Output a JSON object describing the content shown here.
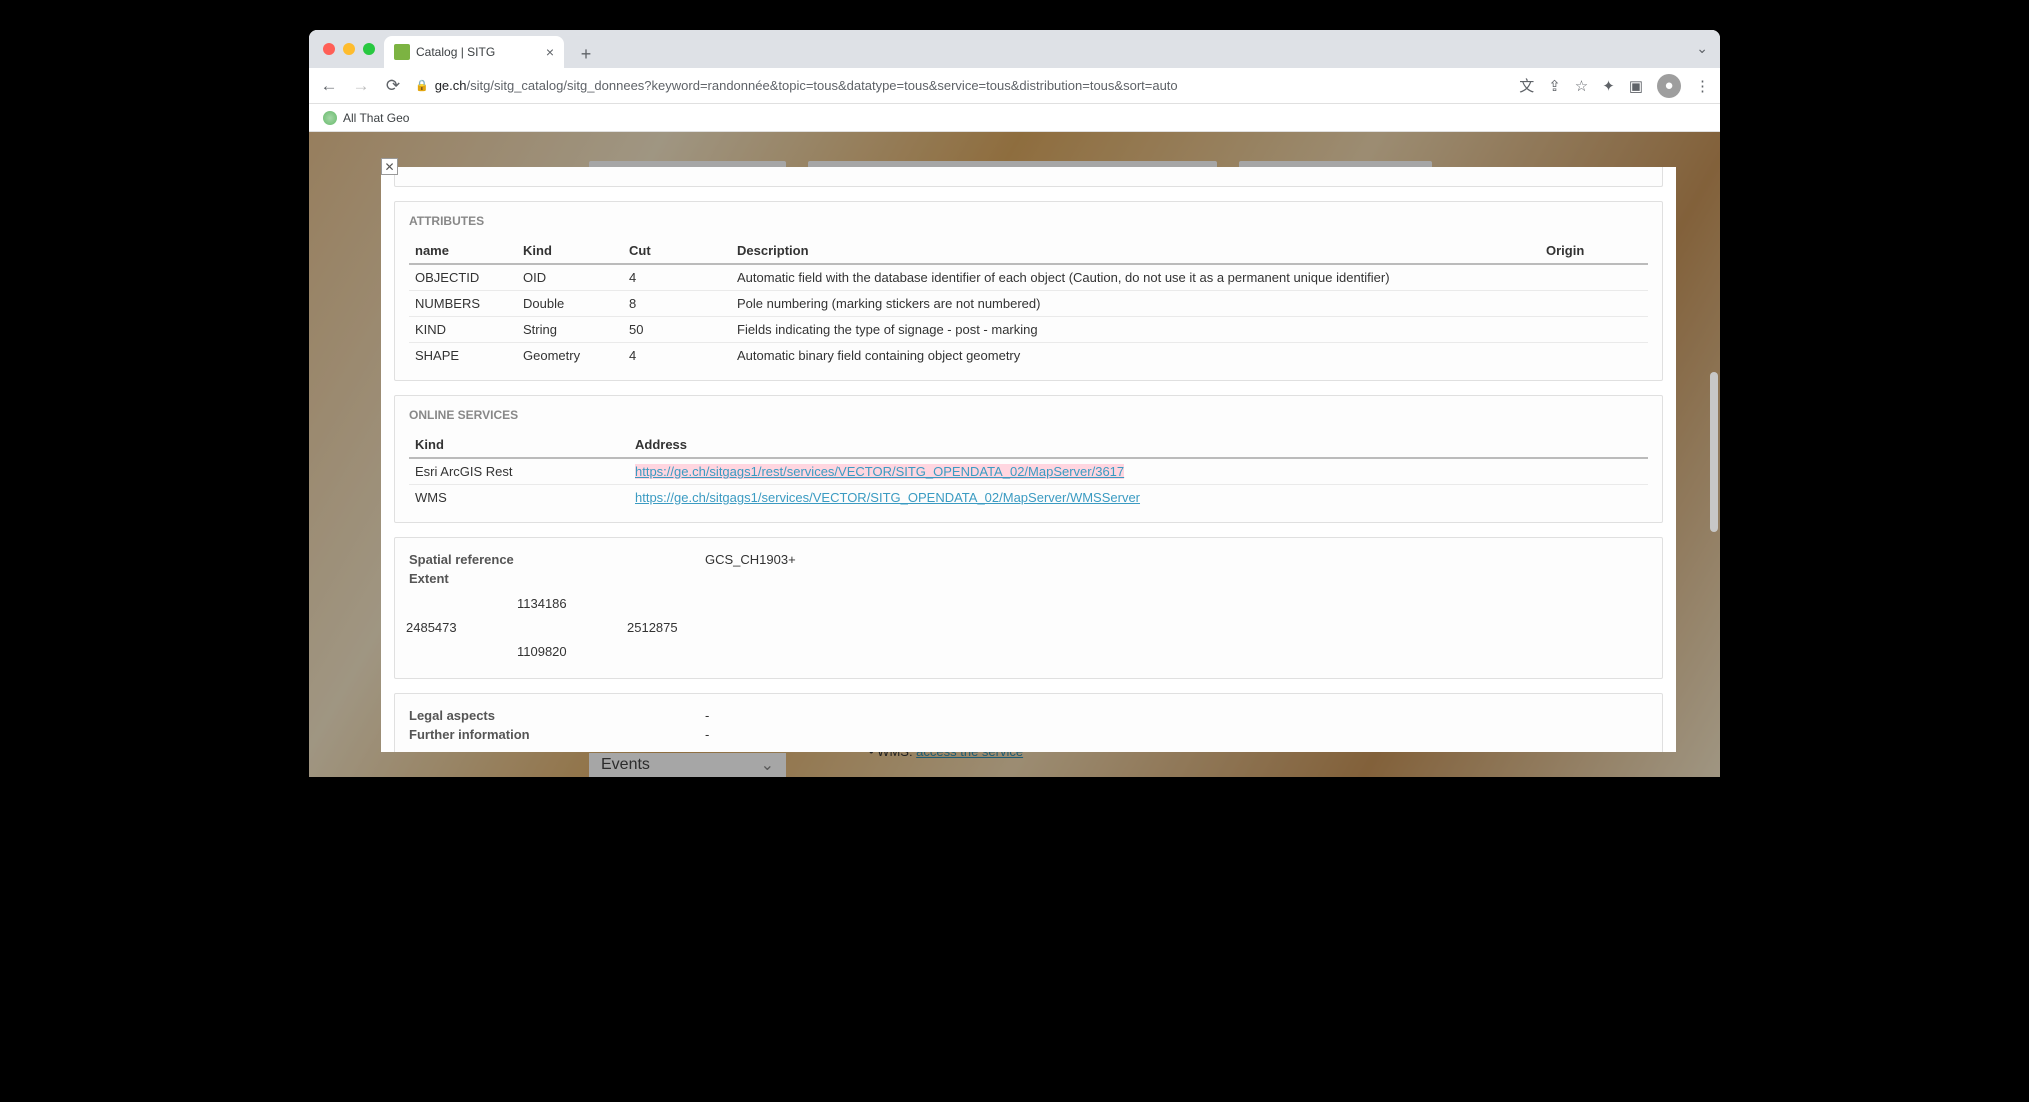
{
  "browser": {
    "tab_title": "Catalog | SITG",
    "url_domain": "ge.ch",
    "url_path": "/sitg/sitg_catalog/sitg_donnees?keyword=randonnée&topic=tous&datatype=tous&service=tous&distribution=tous&sort=auto",
    "bookmark_label": "All That Geo"
  },
  "modal": {
    "attributes": {
      "title": "ATTRIBUTES",
      "headers": {
        "name": "name",
        "kind": "Kind",
        "cut": "Cut",
        "description": "Description",
        "origin": "Origin"
      },
      "rows": [
        {
          "name": "OBJECTID",
          "kind": "OID",
          "cut": "4",
          "description": "Automatic field with the database identifier of each object (Caution, do not use it as a permanent unique identifier)",
          "origin": ""
        },
        {
          "name": "NUMBERS",
          "kind": "Double",
          "cut": "8",
          "description": "Pole numbering (marking stickers are not numbered)",
          "origin": ""
        },
        {
          "name": "KIND",
          "kind": "String",
          "cut": "50",
          "description": "Fields indicating the type of signage - post - marking",
          "origin": ""
        },
        {
          "name": "SHAPE",
          "kind": "Geometry",
          "cut": "4",
          "description": "Automatic binary field containing object geometry",
          "origin": ""
        }
      ]
    },
    "services": {
      "title": "ONLINE SERVICES",
      "headers": {
        "kind": "Kind",
        "address": "Address"
      },
      "rows": [
        {
          "kind": "Esri ArcGIS Rest",
          "address": "https://ge.ch/sitgags1/rest/services/VECTOR/SITG_OPENDATA_02/MapServer/3617",
          "highlighted": true
        },
        {
          "kind": "WMS",
          "address": "https://ge.ch/sitgags1/services/VECTOR/SITG_OPENDATA_02/MapServer/WMSServer",
          "highlighted": false
        }
      ]
    },
    "spatial": {
      "ref_label": "Spatial reference",
      "ref_value": "GCS_CH1903+",
      "extent_label": "Extent",
      "extent": {
        "north": "1134186",
        "west": "2485473",
        "east": "2512875",
        "south": "1109820"
      }
    },
    "footer": {
      "legal_label": "Legal aspects",
      "legal_value": "-",
      "further_label": "Further information",
      "further_value": "-"
    }
  },
  "backdrop": {
    "sidebar_item": "Events",
    "service_prefix": "WMS: ",
    "service_link": "access the service"
  }
}
